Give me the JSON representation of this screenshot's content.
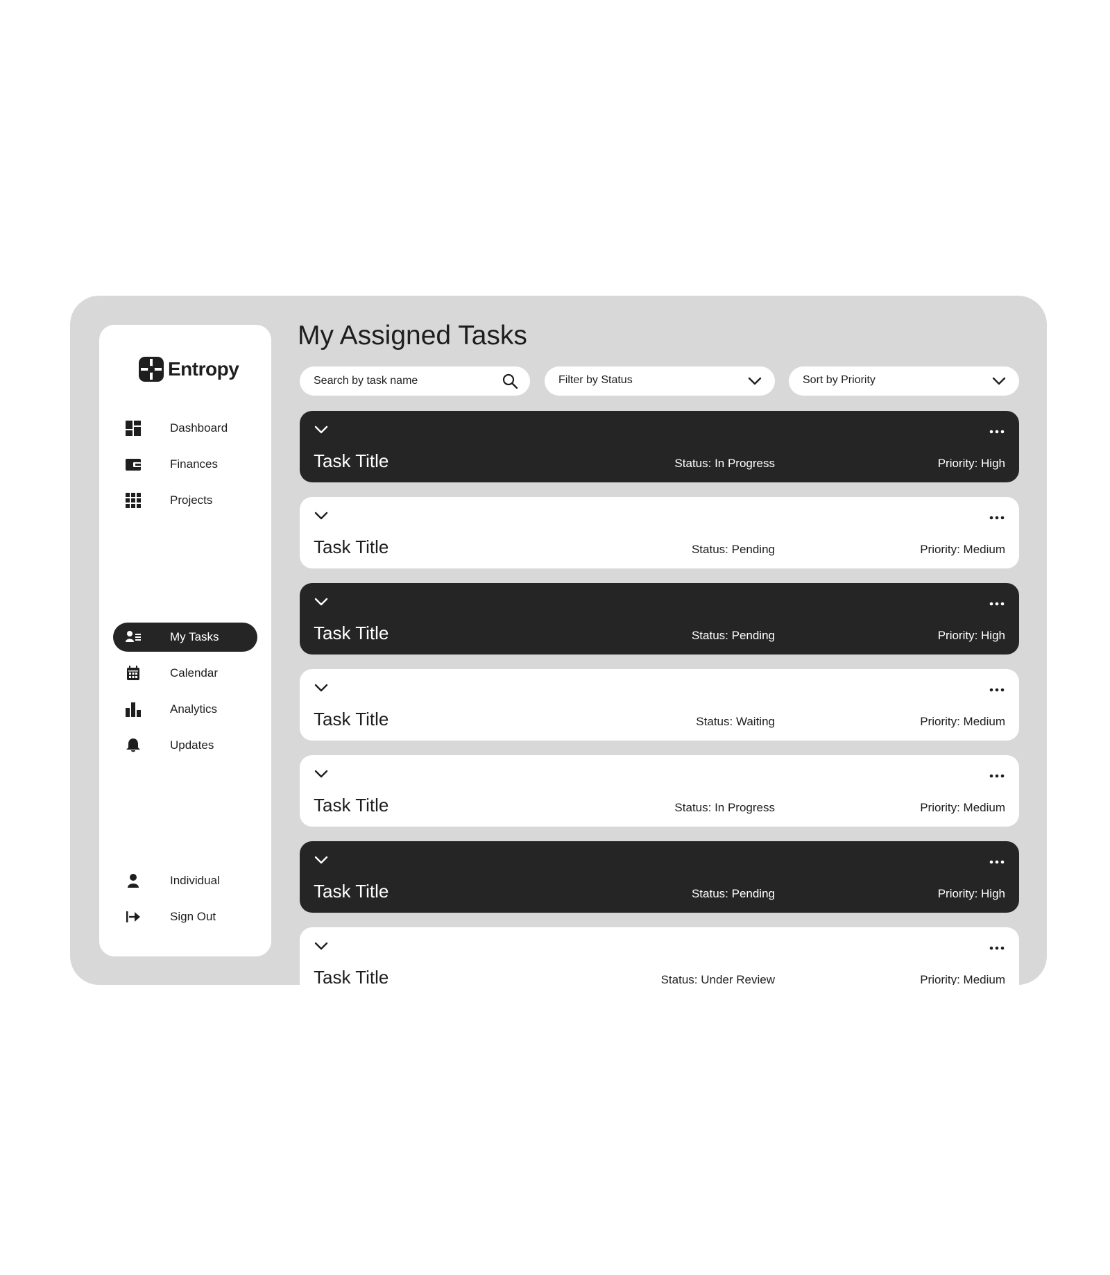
{
  "brand": {
    "name": "Entropy"
  },
  "sidebar": {
    "items": [
      {
        "label": "Dashboard",
        "icon": "dashboard-icon"
      },
      {
        "label": "Finances",
        "icon": "wallet-icon"
      },
      {
        "label": "Projects",
        "icon": "grid-icon"
      },
      {
        "label": "My Tasks",
        "icon": "user-list-icon",
        "active": true
      },
      {
        "label": "Calendar",
        "icon": "calendar-icon"
      },
      {
        "label": "Analytics",
        "icon": "bar-chart-icon"
      },
      {
        "label": "Updates",
        "icon": "bell-icon"
      },
      {
        "label": "Individual",
        "icon": "person-icon"
      },
      {
        "label": "Sign Out",
        "icon": "sign-out-icon"
      }
    ]
  },
  "main": {
    "title": "My Assigned Tasks",
    "search": {
      "placeholder": "Search by task name",
      "value": ""
    },
    "filter": {
      "label": "Filter by Status"
    },
    "sort": {
      "label": "Sort by Priority"
    }
  },
  "tasks": [
    {
      "title": "Task Title",
      "status": "Status: In Progress",
      "priority": "Priority: High",
      "theme": "dark"
    },
    {
      "title": "Task Title",
      "status": "Status: Pending",
      "priority": "Priority: Medium",
      "theme": "light"
    },
    {
      "title": "Task Title",
      "status": "Status: Pending",
      "priority": "Priority: High",
      "theme": "dark"
    },
    {
      "title": "Task Title",
      "status": "Status: Waiting",
      "priority": "Priority: Medium",
      "theme": "light"
    },
    {
      "title": "Task Title",
      "status": "Status: In Progress",
      "priority": "Priority: Medium",
      "theme": "light"
    },
    {
      "title": "Task Title",
      "status": "Status: Pending",
      "priority": "Priority: High",
      "theme": "dark"
    },
    {
      "title": "Task Title",
      "status": "Status: Under Review",
      "priority": "Priority: Medium",
      "theme": "light"
    }
  ],
  "colors": {
    "frame": "#d8d8d8",
    "dark": "#252525",
    "light": "#ffffff",
    "text": "#1e1e1e"
  }
}
